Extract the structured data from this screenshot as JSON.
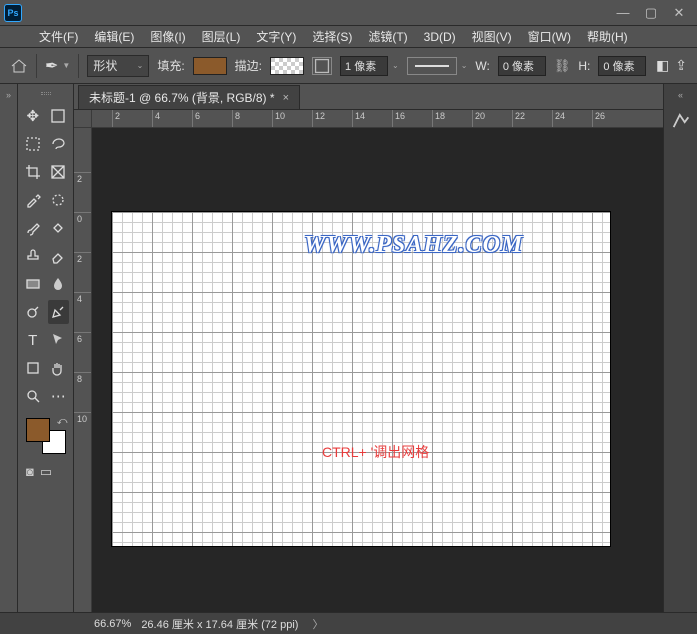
{
  "app": {
    "logo_text": "Ps"
  },
  "menubar": {
    "file": "文件(F)",
    "edit": "编辑(E)",
    "image": "图像(I)",
    "layer": "图层(L)",
    "type": "文字(Y)",
    "select": "选择(S)",
    "filter": "滤镜(T)",
    "threeD": "3D(D)",
    "view": "视图(V)",
    "window": "窗口(W)",
    "help": "帮助(H)"
  },
  "optbar": {
    "mode_label": "形状",
    "fill_label": "填充:",
    "stroke_label": "描边:",
    "stroke_width": "1 像素",
    "w_label": "W:",
    "w_value": "0 像素",
    "h_label": "H:",
    "h_value": "0 像素"
  },
  "tabs": {
    "doc_title": "未标题-1 @ 66.7% (背景, RGB/8) *"
  },
  "h_ruler": [
    "2",
    "4",
    "6",
    "8",
    "10",
    "12",
    "14",
    "16",
    "18",
    "20",
    "22",
    "24",
    "26"
  ],
  "v_ruler_neg": [
    "2"
  ],
  "v_ruler_pos": [
    "0",
    "2",
    "4",
    "6",
    "8",
    "10"
  ],
  "canvas": {
    "watermark": "WWW.PSAHZ.COM",
    "hint": "CTRL+   '调出网格"
  },
  "status": {
    "zoom": "66.67%",
    "docinfo": "26.46 厘米 x 17.64 厘米 (72 ppi)"
  }
}
